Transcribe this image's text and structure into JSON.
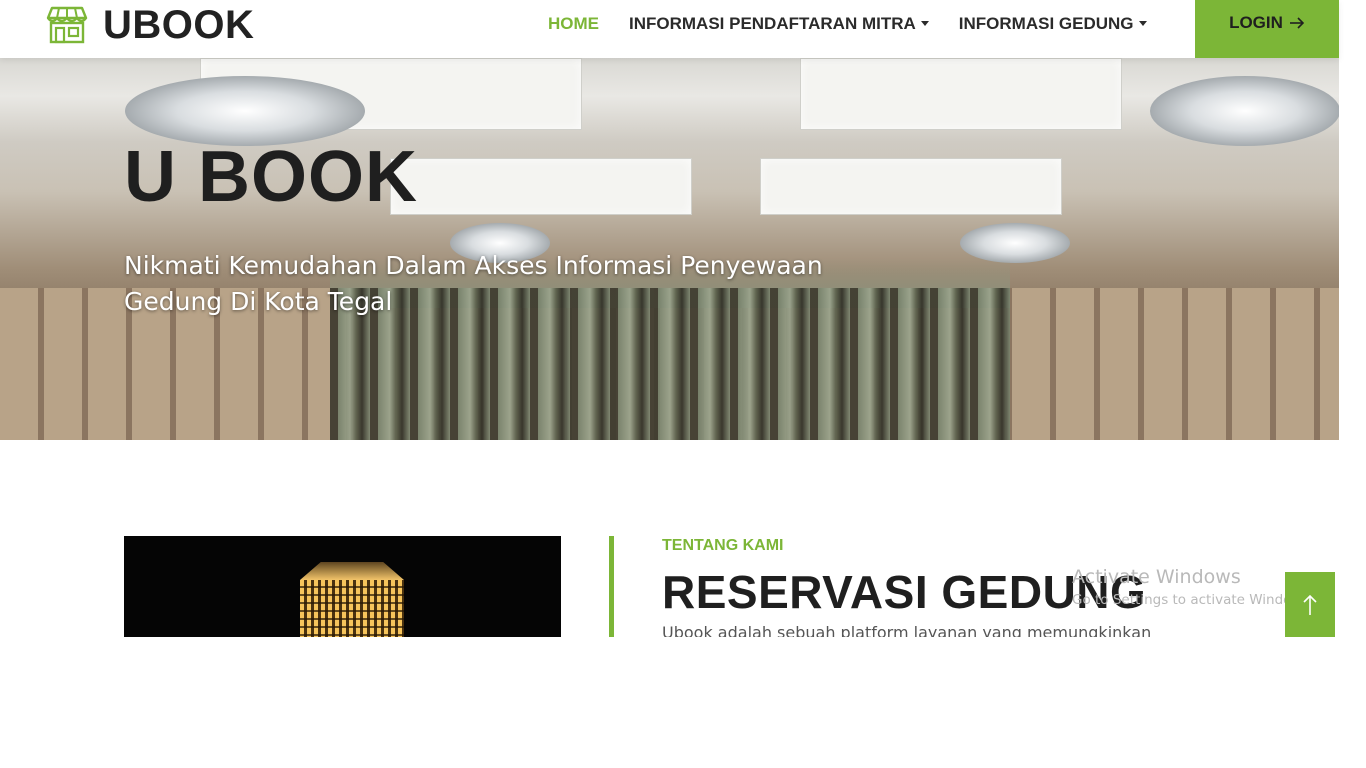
{
  "header": {
    "brand": "UBOOK",
    "nav": [
      {
        "label": "HOME",
        "active": true
      },
      {
        "label": "INFORMASI PENDAFTARAN MITRA",
        "dropdown": true
      },
      {
        "label": "INFORMASI GEDUNG",
        "dropdown": true
      }
    ],
    "login_label": "LOGIN"
  },
  "hero": {
    "title": "U BOOK",
    "subtitle_line1": "Nikmati Kemudahan Dalam Akses Informasi Penyewaan",
    "subtitle_line2": "Gedung Di Kota Tegal"
  },
  "about": {
    "tag": "TENTANG KAMI",
    "title": "RESERVASI GEDUNG",
    "text": "Ubook adalah sebuah platform layanan yang memungkinkan"
  },
  "watermark": {
    "title": "Activate Windows",
    "subtitle": "Go to Settings to activate Windows."
  },
  "colors": {
    "accent": "#7cb637",
    "dark_text": "#1f1f1f"
  },
  "icons": {
    "logo": "storefront-icon",
    "login": "arrow-right-icon",
    "back_to_top": "arrow-up-icon",
    "nav_dropdown": "caret-down-icon"
  }
}
